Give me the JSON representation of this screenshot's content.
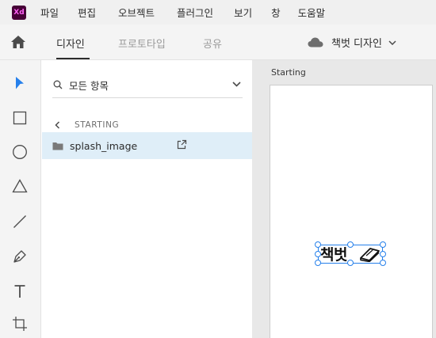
{
  "app": {
    "logo_text": "Xd"
  },
  "menu": [
    "파일",
    "편집",
    "오브젝트",
    "플러그인",
    "보기",
    "창",
    "도움말"
  ],
  "mode_tabs": [
    {
      "label": "디자인",
      "active": true
    },
    {
      "label": "프로토타입",
      "active": false
    },
    {
      "label": "공유",
      "active": false
    }
  ],
  "document": {
    "title": "책벗 디자인",
    "cloud_icon": "cloud-icon"
  },
  "tools": [
    "select-arrow-icon",
    "rectangle-icon",
    "ellipse-icon",
    "polygon-icon",
    "line-icon",
    "pen-icon",
    "text-icon",
    "artboard-icon"
  ],
  "layers": {
    "search_text": "모든 항목",
    "breadcrumb": "STARTING",
    "items": [
      {
        "name": "splash_image",
        "selected": true
      }
    ]
  },
  "canvas": {
    "artboard_name": "Starting",
    "logo_text": "책벗"
  },
  "colors": {
    "accent": "#2680eb",
    "selected_row": "#dfeef8",
    "tool_active": "#2680eb",
    "xd_brand_bg": "#470137",
    "xd_brand_fg": "#ff61f6"
  }
}
